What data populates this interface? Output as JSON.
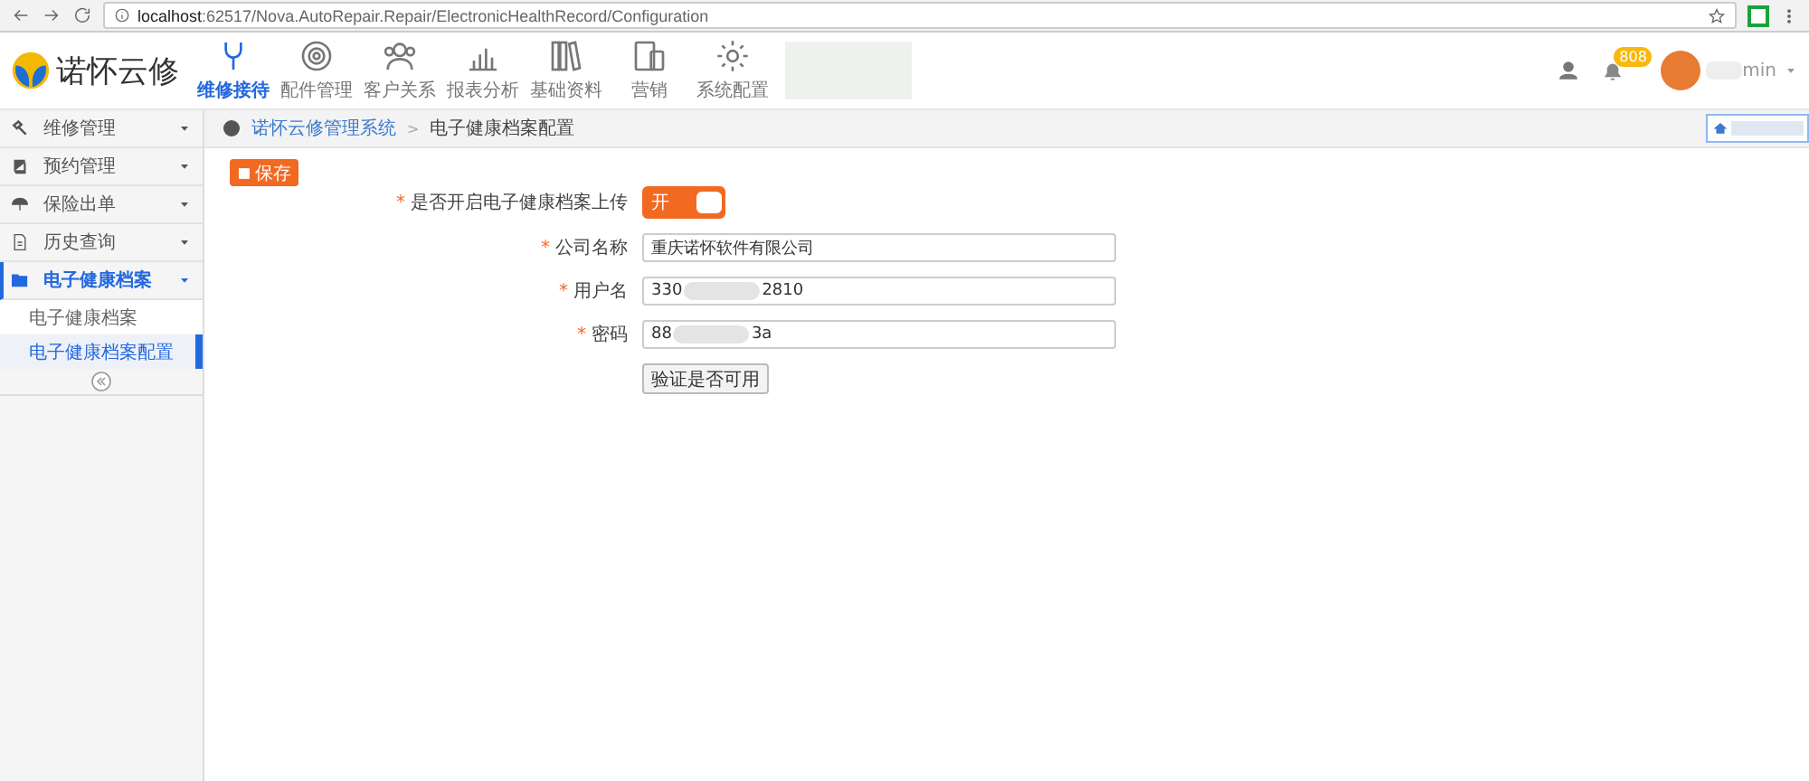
{
  "browser": {
    "url_host": "localhost",
    "url_path": ":62517/Nova.AutoRepair.Repair/ElectronicHealthRecord/Configuration"
  },
  "header": {
    "logo_text": "诺怀云修",
    "nav": [
      {
        "label": "维修接待",
        "selected": true
      },
      {
        "label": "配件管理",
        "selected": false
      },
      {
        "label": "客户关系",
        "selected": false
      },
      {
        "label": "报表分析",
        "selected": false
      },
      {
        "label": "基础资料",
        "selected": false
      },
      {
        "label": "营销",
        "selected": false
      },
      {
        "label": "系统配置",
        "selected": false
      }
    ],
    "notification_count": "808",
    "user_name": "min"
  },
  "sidebar": {
    "items": [
      {
        "label": "维修管理",
        "expanded": false
      },
      {
        "label": "预约管理",
        "expanded": false
      },
      {
        "label": "保险出单",
        "expanded": false
      },
      {
        "label": "历史查询",
        "expanded": false
      },
      {
        "label": "电子健康档案",
        "expanded": true,
        "children": [
          {
            "label": "电子健康档案",
            "selected": false
          },
          {
            "label": "电子健康档案配置",
            "selected": true
          }
        ]
      }
    ]
  },
  "breadcrumb": {
    "items": [
      "诺怀云修管理系统",
      "电子健康档案配置"
    ],
    "separator": ">"
  },
  "required_mark": "*",
  "save_button": "保存",
  "form": [
    {
      "kind": "toggle",
      "label": "是否开启电子健康档案上传",
      "on": true,
      "on_text": "开"
    },
    {
      "kind": "text",
      "label": "公司名称",
      "value": "重庆诺怀软件有限公司"
    },
    {
      "kind": "masked",
      "label": "用户名",
      "value_start": "330",
      "value_end": "2810"
    },
    {
      "kind": "masked",
      "label": "密码",
      "value_start": "88",
      "value_end": "3a"
    },
    {
      "kind": "button",
      "label": "验证是否可用"
    }
  ]
}
